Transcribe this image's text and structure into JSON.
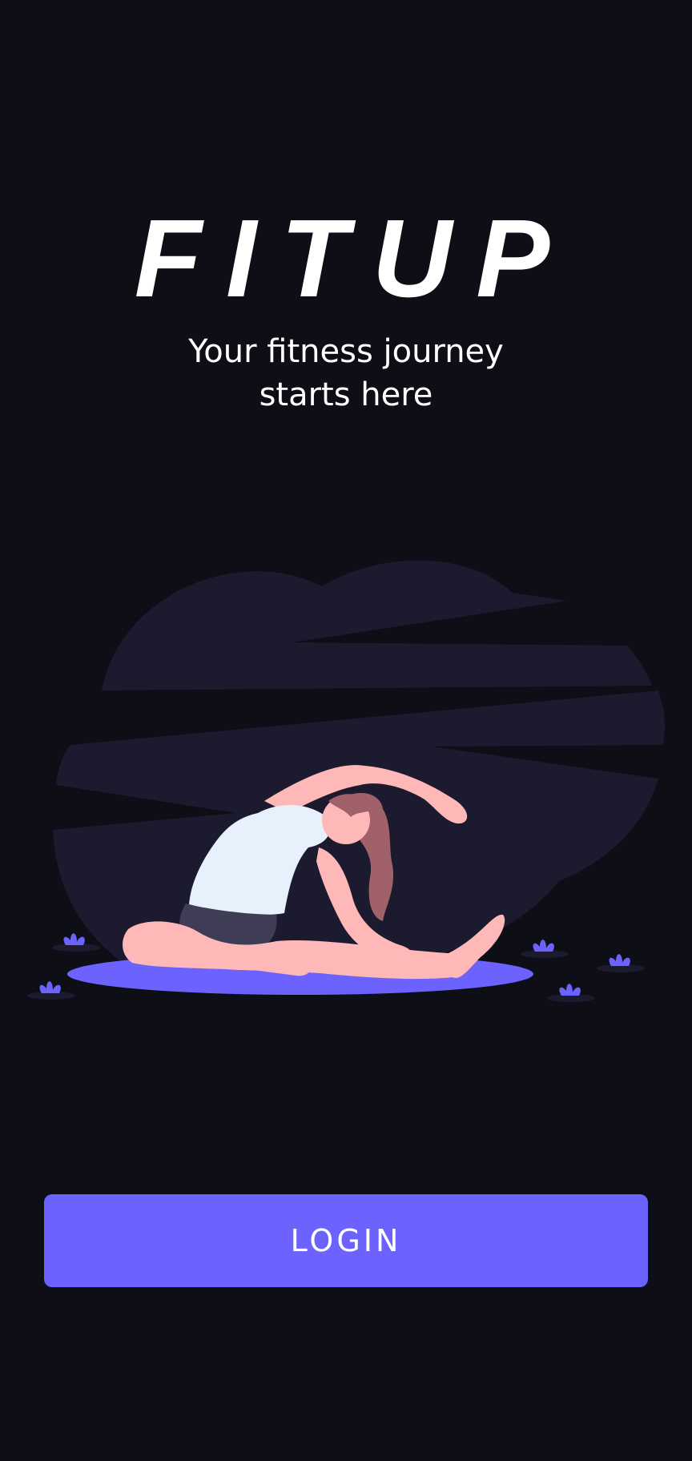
{
  "app": {
    "title": "FITUP",
    "tagline_line1": "Your fitness journey",
    "tagline_line2": "starts here"
  },
  "actions": {
    "login_label": "LOGIN"
  },
  "colors": {
    "background": "#0e0e16",
    "accent": "#6c63ff",
    "cloud": "#1b1a2f",
    "skin": "#ffb8b8",
    "hair": "#a0616a",
    "shirt": "#e6f1fb",
    "shorts": "#3f3d56"
  },
  "illustration": {
    "icon": "yoga-stretch-illustration"
  }
}
